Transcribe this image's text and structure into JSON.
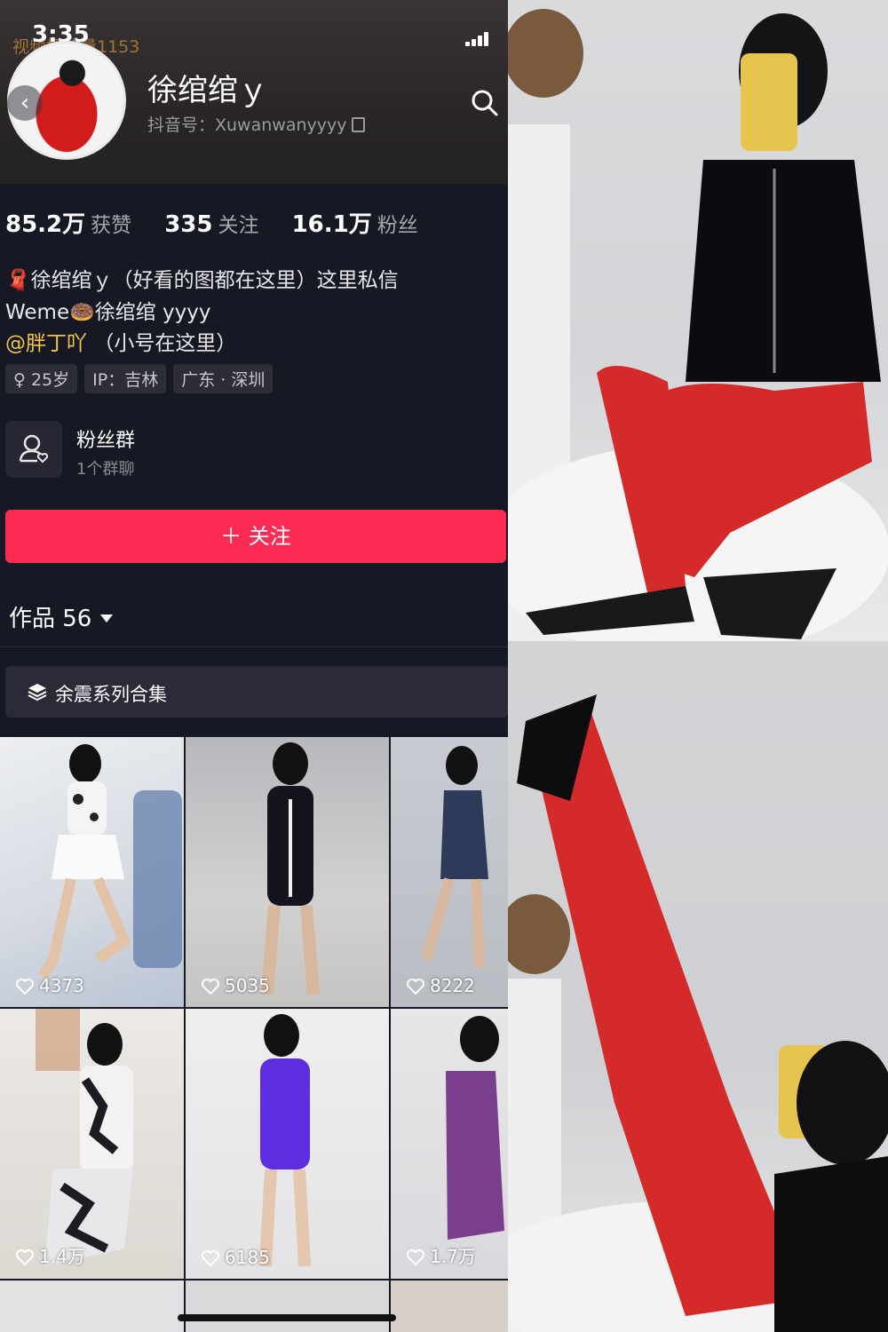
{
  "status_bar": {
    "time": "3:35"
  },
  "watermark": "视频播放量1153",
  "profile": {
    "name": "徐绾绾ｙ",
    "douyin_id": "抖音号：Xuwanwanyyyy"
  },
  "stats": [
    {
      "value": "85.2万",
      "label": "获赞"
    },
    {
      "value": "335",
      "label": "关注"
    },
    {
      "value": "16.1万",
      "label": "粉丝"
    }
  ],
  "bio": {
    "line1": "🧣徐绾绾ｙ（好看的图都在这里）这里私信",
    "line2": "Weme🍩徐绾绾 yyyy",
    "mention": "@胖丁吖",
    "line3_rest": "（小号在这里）"
  },
  "tags": [
    "♀ 25岁",
    "IP：吉林",
    "广东 · 深圳"
  ],
  "fan_group": {
    "title": "粉丝群",
    "subtitle": "1个群聊"
  },
  "follow_button": "＋ 关注",
  "works": {
    "label": "作品 56"
  },
  "collection": {
    "label": "余震系列合集"
  },
  "videos": [
    {
      "likes": "4373"
    },
    {
      "likes": "5035"
    },
    {
      "likes": "8222"
    },
    {
      "likes": "1.4万"
    },
    {
      "likes": "6185"
    },
    {
      "likes": "1.7万"
    }
  ],
  "colors": {
    "background": "#161823",
    "accent": "#fe2c55",
    "mention": "#f0c64a",
    "muted_text": "#a6a7ad"
  },
  "icons": [
    "back-icon",
    "search-icon",
    "copy-icon",
    "fan-group-icon",
    "layers-icon",
    "heart-icon",
    "chevron-down-icon"
  ]
}
